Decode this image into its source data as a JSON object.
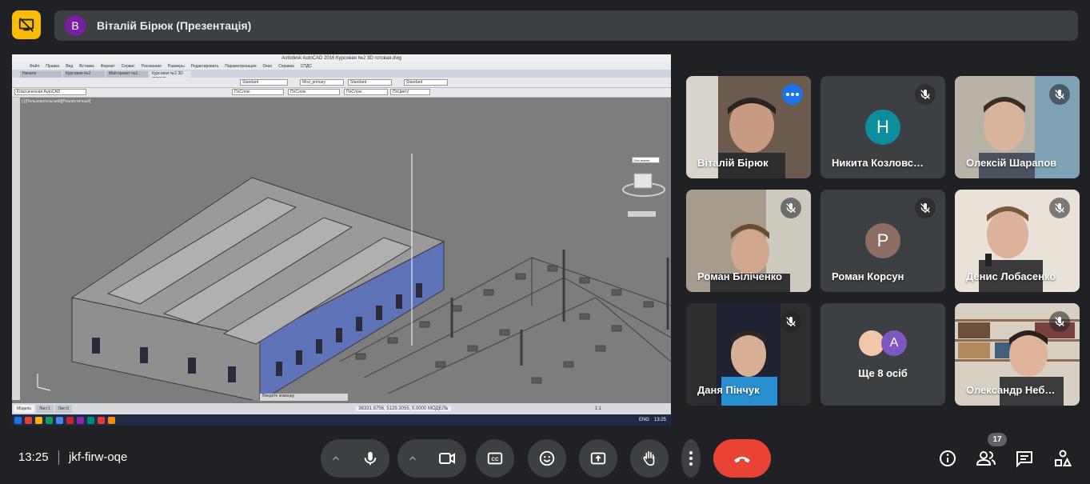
{
  "presenter": {
    "avatar_letter": "B",
    "avatar_color": "#7b1fa2",
    "label": "Віталій Бірюк (Презентація)"
  },
  "autocad": {
    "title": "Autodesk AutoCAD 2016   Курсовая №2 3D готовая.dwg",
    "menu": [
      "Файл",
      "Правка",
      "Вид",
      "Вставка",
      "Формат",
      "Сервис",
      "Рисование",
      "Размеры",
      "Редактировать",
      "Параметризация",
      "Окно",
      "Справка",
      "СПДС"
    ],
    "tabs": [
      "Начало",
      "Курсовая №2",
      "Мой проект №1",
      "Курсовая №2 3D готовая"
    ],
    "workspace": "Классическая AutoCAD",
    "style1": "Standard",
    "style2": "Mod_primary",
    "style3": "Standard",
    "style4": "Standard",
    "layer_color": "ПоСлою",
    "linetype": "ПоСлою",
    "lineweight": "ПоСлою",
    "plotstyle": "ПоЦвету",
    "viewport_label": "[-][Пользовательский][Реалистичный]",
    "viewcube_label": "Без имени",
    "cmd_placeholder": "Введите команду",
    "layout_tabs": [
      "Модель",
      "Лист1",
      "Лист2"
    ],
    "coords": "36331.8756, 5129.3055, 0.0000   МОДЕЛЬ",
    "status_scale": "1:1",
    "taskbar_lang": "ENG",
    "taskbar_time": "13:25"
  },
  "colors": {
    "accent": "#8ab4f8",
    "hangup": "#ea4335",
    "badge": "#fbbc04",
    "tile_bg": "#3c4043"
  },
  "tiles": [
    {
      "name": "Віталій Бірюк",
      "type": "video",
      "speaking": true
    },
    {
      "name": "Никита Козловс…",
      "type": "avatar",
      "letter": "Н",
      "color": "#0e8e9c"
    },
    {
      "name": "Олексій Шарапов",
      "type": "video"
    },
    {
      "name": "Роман Біліченко",
      "type": "video"
    },
    {
      "name": "Роман Корсун",
      "type": "avatar",
      "letter": "P",
      "color": "#8d6e63"
    },
    {
      "name": "Денис Лобасенко",
      "type": "video"
    },
    {
      "name": "Даня Пінчук",
      "type": "video"
    },
    {
      "name": "Ще 8 осіб",
      "type": "others",
      "letter": "A",
      "color": "#7e57c2"
    },
    {
      "name": "Олександр Неб…",
      "type": "video"
    }
  ],
  "footer": {
    "time": "13:25",
    "meeting_code": "jkf-firw-oqe",
    "participants_count": "17"
  },
  "icons": [
    "presentation-off-icon",
    "mic-off-icon",
    "more-dots-icon",
    "mic-icon",
    "camera-icon",
    "captions-icon",
    "emoji-icon",
    "present-screen-icon",
    "raise-hand-icon",
    "more-vert-icon",
    "hangup-icon",
    "info-icon",
    "people-icon",
    "chat-icon",
    "activities-icon",
    "chevron-up-icon"
  ]
}
